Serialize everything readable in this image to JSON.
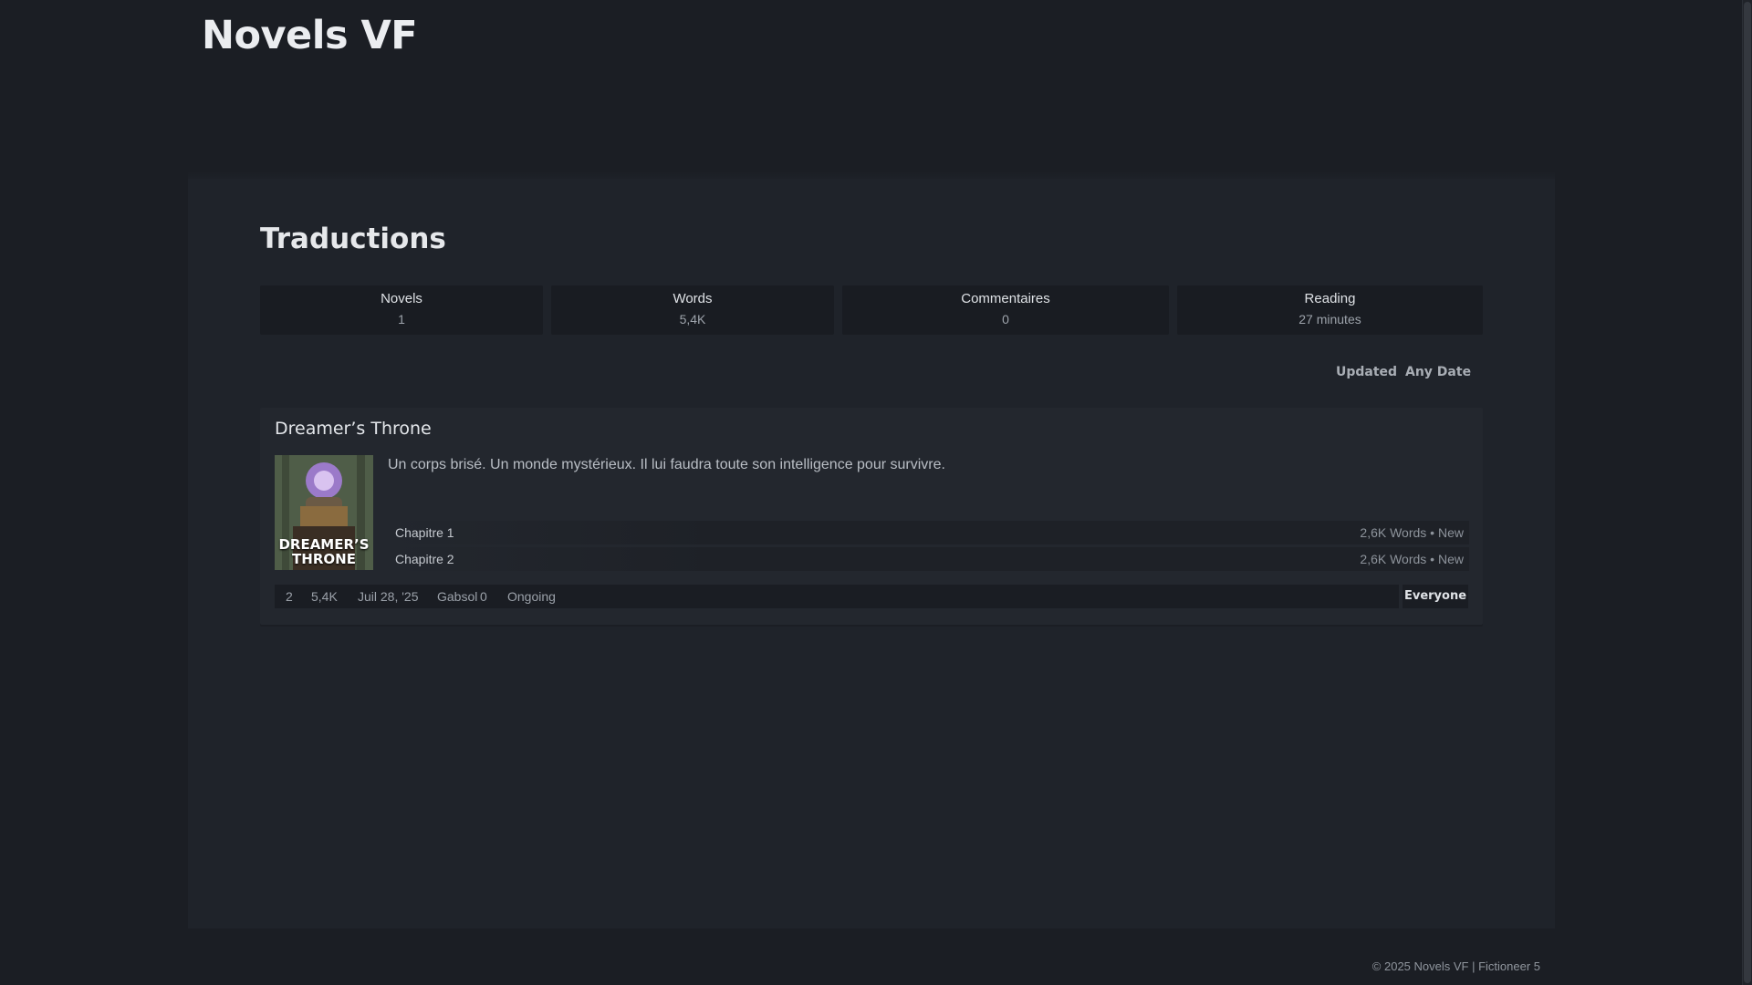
{
  "site": {
    "title": "Novels VF"
  },
  "page": {
    "heading": "Traductions"
  },
  "stats": [
    {
      "label": "Novels",
      "value": "1"
    },
    {
      "label": "Words",
      "value": "5,4K"
    },
    {
      "label": "Commentaires",
      "value": "0"
    },
    {
      "label": "Reading",
      "value": "27 minutes"
    }
  ],
  "sort": {
    "order": "Updated",
    "date": "Any Date"
  },
  "story": {
    "title": "Dreamer’s Throne",
    "cover_text": "DREAMER’S THRONE",
    "description": "Un corps brisé. Un monde mystérieux. Il lui faudra toute son intelligence pour survivre.",
    "chapters": [
      {
        "name": "Chapitre 1",
        "words": "2,6K Words",
        "status": "New"
      },
      {
        "name": "Chapitre 2",
        "words": "2,6K Words",
        "status": "New"
      }
    ],
    "footer": {
      "chapters": "2",
      "words": "5,4K",
      "date": "Juil 28, '25",
      "author": "Gabsol",
      "comments": "0",
      "status": "Ongoing"
    },
    "rating": "Everyone"
  },
  "footer": {
    "copyright": "© 2025 Novels VF | Fictioneer 5"
  },
  "colors": {
    "background": "#1b1e24",
    "panel": "#1f232a",
    "card": "#23272e"
  }
}
